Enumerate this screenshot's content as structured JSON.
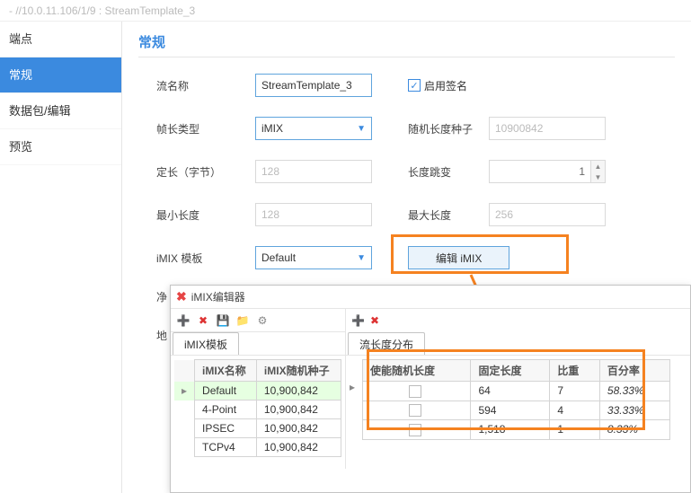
{
  "window": {
    "title": "- //10.0.11.106/1/9 : StreamTemplate_3"
  },
  "sidebar": {
    "items": [
      {
        "label": "端点"
      },
      {
        "label": "常规"
      },
      {
        "label": "数据包/编辑"
      },
      {
        "label": "预览"
      }
    ]
  },
  "section": {
    "title": "常规"
  },
  "form": {
    "stream_name_label": "流名称",
    "stream_name_value": "StreamTemplate_3",
    "enable_sign_label": "启用签名",
    "frame_type_label": "帧长类型",
    "frame_type_value": "iMIX",
    "random_seed_label": "随机长度种子",
    "random_seed_value": "10900842",
    "fixed_len_label": "定长（字节）",
    "fixed_len_value": "128",
    "len_jump_label": "长度跳变",
    "len_jump_value": "1",
    "min_len_label": "最小长度",
    "min_len_value": "128",
    "max_len_label": "最大长度",
    "max_len_value": "256",
    "imix_tpl_label": "iMIX 模板",
    "imix_tpl_value": "Default",
    "edit_imix_btn": "编辑 iMIX",
    "net_label": "净",
    "addr_label": "地"
  },
  "popup": {
    "title": "iMIX编辑器",
    "left_tab": "iMIX模板",
    "right_tab": "流长度分布",
    "left_headers": [
      "iMIX名称",
      "iMIX随机种子"
    ],
    "left_rows": [
      {
        "name": "Default",
        "seed": "10,900,842",
        "selected": true
      },
      {
        "name": "4-Point",
        "seed": "10,900,842"
      },
      {
        "name": "IPSEC",
        "seed": "10,900,842"
      },
      {
        "name": "TCPv4",
        "seed": "10,900,842"
      }
    ],
    "right_headers": [
      "使能随机长度",
      "固定长度",
      "比重",
      "百分率"
    ],
    "right_rows": [
      {
        "rand": false,
        "len": "64",
        "weight": "7",
        "pct": "58.33%"
      },
      {
        "rand": false,
        "len": "594",
        "weight": "4",
        "pct": "33.33%"
      },
      {
        "rand": false,
        "len": "1,518",
        "weight": "1",
        "pct": "8.33%"
      }
    ]
  }
}
